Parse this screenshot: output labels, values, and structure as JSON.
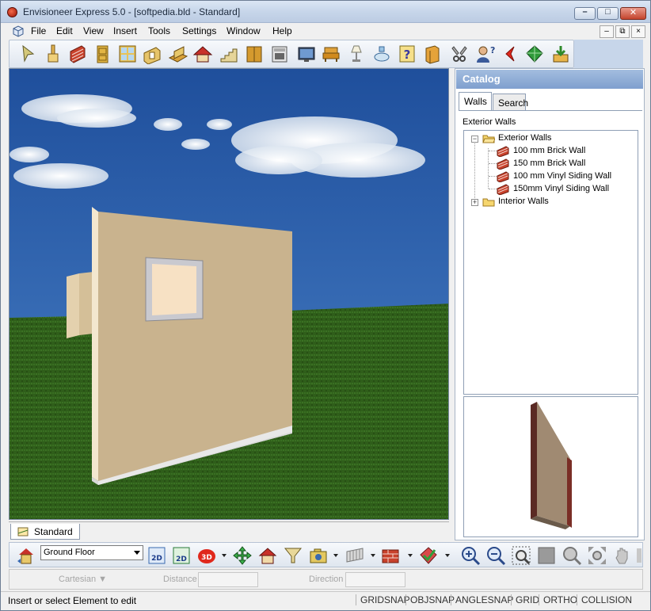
{
  "window": {
    "title": "Envisioneer Express 5.0 - [softpedia.bld - Standard]",
    "controls": {
      "minimize": "–",
      "maximize": "□",
      "close": "✕"
    }
  },
  "menu": [
    "File",
    "Edit",
    "View",
    "Insert",
    "Tools",
    "Settings",
    "Window",
    "Help"
  ],
  "mdi_controls": {
    "minimize": "–",
    "restore": "⧉",
    "close": "×"
  },
  "main_toolbar": {
    "icons": [
      "select-arrow-icon",
      "paint-brush-icon",
      "brick-wall-icon",
      "door-icon",
      "window-icon",
      "opening-icon",
      "floor-icon",
      "roof-icon",
      "stairs-icon",
      "cabinet-icon",
      "appliance-icon",
      "electronics-icon",
      "furniture-icon",
      "lamp-icon",
      "plumbing-icon",
      "help-icon",
      "catalog-book-icon",
      "tools-icon",
      "user-help-icon",
      "red-arrow-icon",
      "green-gem-icon",
      "download-icon"
    ]
  },
  "viewport": {
    "sky_color": "#2b5fa8",
    "ground_color": "#2f5e1a",
    "wall_color": "#c9b38e"
  },
  "view_tabs": [
    {
      "label": "Standard"
    }
  ],
  "catalog": {
    "header": "Catalog",
    "tabs": [
      "Walls",
      "Search"
    ],
    "active_tab": "Walls",
    "section_label": "Exterior Walls",
    "tree": {
      "groups": [
        {
          "label": "Exterior Walls",
          "expanded": true,
          "items": [
            "100 mm Brick Wall",
            "150 mm Brick Wall",
            "100 mm Vinyl Siding Wall",
            "150mm Vinyl Siding Wall"
          ]
        },
        {
          "label": "Interior Walls",
          "expanded": false,
          "items": []
        }
      ]
    }
  },
  "bottom_toolbar": {
    "floor_select": "Ground Floor",
    "icons": [
      "floor-manager-icon",
      "2d-view-icon",
      "2d-plan-icon",
      "3d-view-icon",
      "move-icon",
      "house-icon",
      "funnel-icon",
      "camera-icon",
      "fence-icon",
      "wall-brick-icon",
      "check-icon",
      "zoom-in-icon",
      "zoom-out-icon",
      "zoom-fit-icon",
      "zoom-box-icon",
      "zoom-region-icon",
      "zoom-extents-icon",
      "pan-hand-icon",
      "orbit-icon"
    ]
  },
  "input_bar": {
    "coord_mode": "Cartesian",
    "distance_label": "Distance",
    "direction_label": "Direction"
  },
  "status": {
    "message": "Insert or select Element to edit",
    "flags": [
      "GRIDSNAP",
      "OBJSNAP",
      "ANGLESNAP",
      "GRID",
      "ORTHO",
      "COLLISION"
    ]
  }
}
